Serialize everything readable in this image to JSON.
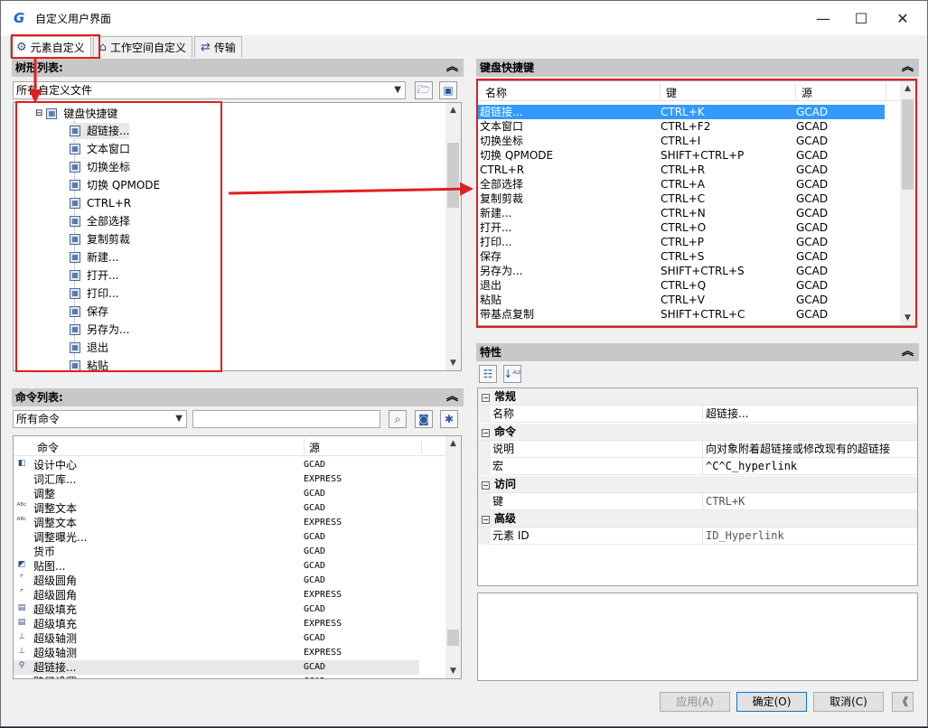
{
  "window": {
    "title": "自定义用户界面",
    "minimize": "—",
    "maximize": "☐",
    "close": "✕"
  },
  "tabs": [
    {
      "label": "元素自定义",
      "icon": "gear-icon",
      "glyph": "⚙"
    },
    {
      "label": "工作空间自定义",
      "icon": "home-icon",
      "glyph": "⌂"
    },
    {
      "label": "传输",
      "icon": "transfer-icon",
      "glyph": "⇄"
    }
  ],
  "tree_panel": {
    "header": "树形列表:",
    "file_combo": "所有自定义文件",
    "root_label": "键盘快捷键",
    "items": [
      "超链接...",
      "文本窗口",
      "切换坐标",
      "切换 QPMODE",
      "CTRL+R",
      "全部选择",
      "复制剪裁",
      "新建...",
      "打开...",
      "打印...",
      "保存",
      "另存为...",
      "退出",
      "粘贴"
    ]
  },
  "command_panel": {
    "header": "命令列表:",
    "filter_combo": "所有命令",
    "search_value": "",
    "columns": [
      "命令",
      "源"
    ],
    "rows": [
      {
        "name": "设计中心",
        "source": "GCAD",
        "icon": "◧"
      },
      {
        "name": "词汇库...",
        "source": "EXPRESS",
        "icon": ""
      },
      {
        "name": "调整",
        "source": "GCAD",
        "icon": ""
      },
      {
        "name": "调整文本",
        "source": "GCAD",
        "icon": "ᴬᴮᶜ"
      },
      {
        "name": "调整文本",
        "source": "EXPRESS",
        "icon": "ᴬᴮᶜ"
      },
      {
        "name": "调整曝光...",
        "source": "GCAD",
        "icon": ""
      },
      {
        "name": "货币",
        "source": "GCAD",
        "icon": ""
      },
      {
        "name": "贴图...",
        "source": "GCAD",
        "icon": "◩"
      },
      {
        "name": "超级圆角",
        "source": "GCAD",
        "icon": "⌜"
      },
      {
        "name": "超级圆角",
        "source": "EXPRESS",
        "icon": "⌜"
      },
      {
        "name": "超级填充",
        "source": "GCAD",
        "icon": "▤"
      },
      {
        "name": "超级填充",
        "source": "EXPRESS",
        "icon": "▤"
      },
      {
        "name": "超级轴测",
        "source": "GCAD",
        "icon": "⊥"
      },
      {
        "name": "超级轴测",
        "source": "EXPRESS",
        "icon": "⊥"
      },
      {
        "name": "超链接...",
        "source": "GCAD",
        "icon": "⚲"
      },
      {
        "name": "路径设置",
        "source": "GCAD",
        "icon": "▬"
      }
    ],
    "selected_index": 14
  },
  "shortcut_panel": {
    "header": "键盘快捷键",
    "columns": [
      "名称",
      "键",
      "源"
    ],
    "rows": [
      {
        "name": "超链接...",
        "key": "CTRL+K",
        "source": "GCAD"
      },
      {
        "name": "文本窗口",
        "key": "CTRL+F2",
        "source": "GCAD"
      },
      {
        "name": "切换坐标",
        "key": "CTRL+I",
        "source": "GCAD"
      },
      {
        "name": "切换 QPMODE",
        "key": "SHIFT+CTRL+P",
        "source": "GCAD"
      },
      {
        "name": "CTRL+R",
        "key": "CTRL+R",
        "source": "GCAD"
      },
      {
        "name": "全部选择",
        "key": "CTRL+A",
        "source": "GCAD"
      },
      {
        "name": "复制剪裁",
        "key": "CTRL+C",
        "source": "GCAD"
      },
      {
        "name": "新建...",
        "key": "CTRL+N",
        "source": "GCAD"
      },
      {
        "name": "打开...",
        "key": "CTRL+O",
        "source": "GCAD"
      },
      {
        "name": "打印...",
        "key": "CTRL+P",
        "source": "GCAD"
      },
      {
        "name": "保存",
        "key": "CTRL+S",
        "source": "GCAD"
      },
      {
        "name": "另存为...",
        "key": "SHIFT+CTRL+S",
        "source": "GCAD"
      },
      {
        "name": "退出",
        "key": "CTRL+Q",
        "source": "GCAD"
      },
      {
        "name": "粘贴",
        "key": "CTRL+V",
        "source": "GCAD"
      },
      {
        "name": "带基点复制",
        "key": "SHIFT+CTRL+C",
        "source": "GCAD"
      }
    ],
    "selected_index": 0
  },
  "properties_panel": {
    "header": "特性",
    "categories": [
      {
        "name": "常规",
        "props": [
          {
            "key": "名称",
            "value": "超链接..."
          }
        ]
      },
      {
        "name": "命令",
        "props": [
          {
            "key": "说明",
            "value": "向对象附着超链接或修改现有的超链接"
          },
          {
            "key": "宏",
            "value": "^C^C_hyperlink"
          }
        ]
      },
      {
        "name": "访问",
        "props": [
          {
            "key": "键",
            "value": "CTRL+K"
          }
        ]
      },
      {
        "name": "高级",
        "props": [
          {
            "key": "元素 ID",
            "value": "ID_Hyperlink"
          }
        ]
      }
    ],
    "collapse_glyph": "−"
  },
  "buttons": {
    "apply": "应用(A)",
    "ok": "确定(O)",
    "cancel": "取消(C)",
    "collapse": "《"
  },
  "annotation_color": "#e02020",
  "selection_color": "#3399ff"
}
